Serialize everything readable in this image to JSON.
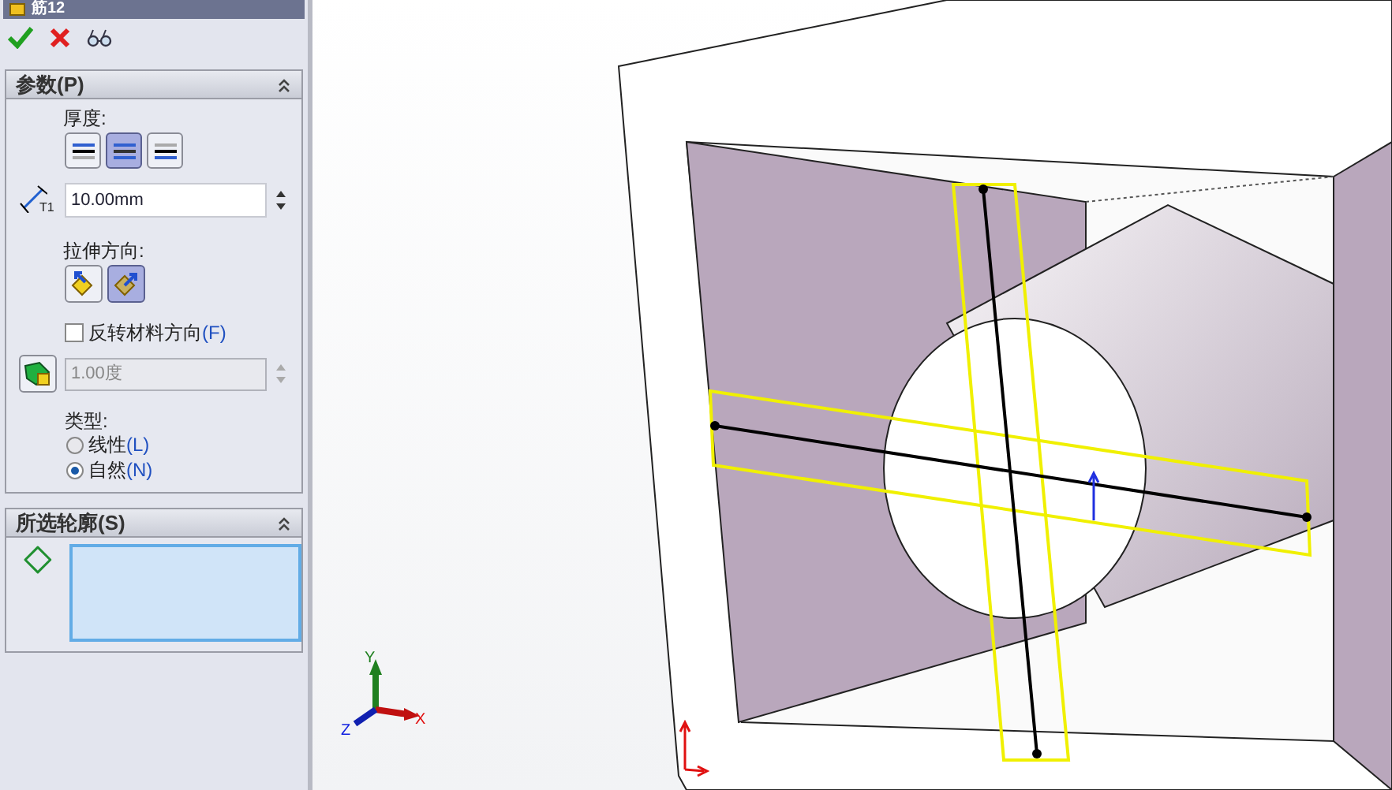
{
  "panel": {
    "title": "筋12",
    "sections": [
      {
        "title": "参数(P)",
        "expanded": true
      },
      {
        "title": "所选轮廓(S)",
        "expanded": true
      }
    ],
    "thickness": {
      "label": "厚度:",
      "options": [
        {
          "selected": false
        },
        {
          "selected": true
        },
        {
          "selected": false
        }
      ]
    },
    "thickness_value": {
      "value": "10.00mm",
      "icon_label": "T1"
    },
    "direction": {
      "label": "拉伸方向:",
      "options": [
        {
          "selected": false
        },
        {
          "selected": true
        }
      ]
    },
    "flip": {
      "label": "反转材料方向",
      "mnemonic": "(F)",
      "checked": false
    },
    "draft": {
      "value": "1.00度",
      "disabled": true
    },
    "type": {
      "label": "类型:",
      "options": [
        {
          "label": "线性",
          "mnemonic": "(L)",
          "selected": false
        },
        {
          "label": "自然",
          "mnemonic": "(N)",
          "selected": true
        }
      ]
    }
  },
  "viewport": {
    "triad": {
      "x": "X",
      "y": "Y",
      "z": "Z"
    }
  }
}
